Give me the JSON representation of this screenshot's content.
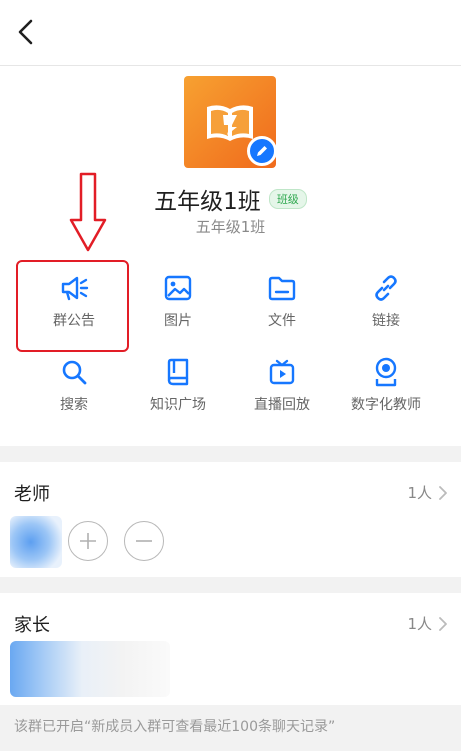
{
  "topbar": {
    "back_icon": "chevron-left-icon"
  },
  "group": {
    "name": "五年级1班",
    "tag": "班级",
    "subtitle": "五年级1班",
    "avatar_icon": "book-logo-icon",
    "edit_icon": "pencil-icon",
    "avatar_color": "#f5851f"
  },
  "tools": [
    {
      "label": "群公告",
      "icon": "megaphone-icon"
    },
    {
      "label": "图片",
      "icon": "image-icon"
    },
    {
      "label": "文件",
      "icon": "folder-icon"
    },
    {
      "label": "链接",
      "icon": "link-icon"
    },
    {
      "label": "搜索",
      "icon": "search-icon"
    },
    {
      "label": "知识广场",
      "icon": "book-icon"
    },
    {
      "label": "直播回放",
      "icon": "tv-icon"
    },
    {
      "label": "数字化教师",
      "icon": "badge-icon"
    }
  ],
  "teachers": {
    "title": "老师",
    "count": "1人"
  },
  "parents": {
    "title": "家长",
    "count": "1人"
  },
  "footer": {
    "note": "该群已开启“新成员入群可查看最近100条聊天记录”"
  },
  "colors": {
    "accent": "#1677ff",
    "highlight": "#e21d26",
    "tag_green": "#2fa84f"
  }
}
